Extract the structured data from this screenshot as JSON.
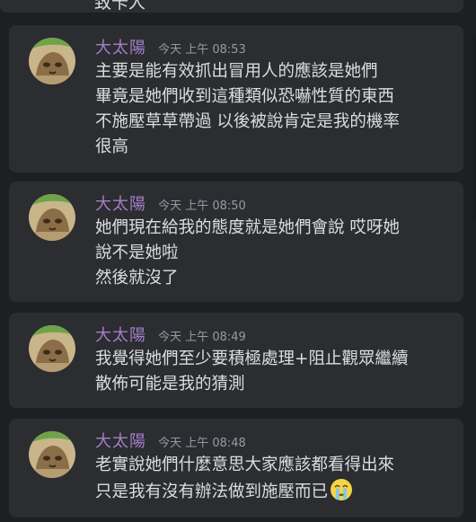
{
  "top_fragment_text": "致卡人",
  "messages": [
    {
      "author": "大太陽",
      "timestamp": "今天 上午 08:53",
      "lines": [
        "主要是能有效抓出冒用人的應該是她們",
        "畢竟是她們收到這種類似恐嚇性質的東西",
        "不施壓草草帶過 以後被說肯定是我的機率",
        "很高"
      ]
    },
    {
      "author": "大太陽",
      "timestamp": "今天 上午 08:50",
      "lines": [
        "她們現在給我的態度就是她們會說 哎呀她",
        "說不是她啦",
        "然後就沒了"
      ]
    },
    {
      "author": "大太陽",
      "timestamp": "今天 上午 08:49",
      "lines": [
        "我覺得她們至少要積極處理+阻止觀眾繼續",
        "散佈可能是我的猜測"
      ]
    },
    {
      "author": "大太陽",
      "timestamp": "今天 上午 08:48",
      "lines": [
        "老實說她們什麼意思大家應該都看得出來",
        "只是我有沒有辦法做到施壓而已"
      ],
      "trailing_emoji": "crying-face-icon"
    }
  ],
  "colors": {
    "background": "#1e1f22",
    "message_background": "#2b2d31",
    "author": "#a67ec8",
    "timestamp": "#949ba4",
    "text": "#dbdee1"
  }
}
